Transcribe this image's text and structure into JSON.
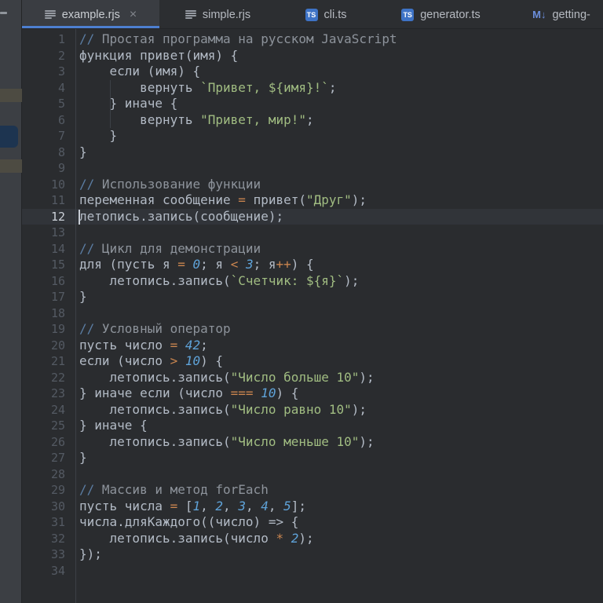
{
  "colors": {
    "accent_tab_underline": "#4d7fd0",
    "ts_icon_bg": "#3e73c6",
    "markdown_icon": "#6b8edb",
    "sidebar_selected_navy": "#1d3450",
    "sidebar_band_olive": "#4d4b42",
    "string_green": "#a1bd82",
    "number_blue": "#5fa3d9",
    "operator_orange": "#c9854f",
    "comment_slash_blue": "#5b7da3",
    "comment_gray": "#8d939b",
    "editor_bg": "#2a2c2f",
    "active_line_bg": "#313439"
  },
  "tab_bar": {
    "tabs": [
      {
        "label": "example.rjs",
        "icon": "file-lines",
        "active": true,
        "close_label": "×"
      },
      {
        "label": "simple.rjs",
        "icon": "file-lines",
        "active": false
      },
      {
        "label": "cli.ts",
        "icon": "ts-badge",
        "icon_text": "TS",
        "active": false
      },
      {
        "label": "generator.ts",
        "icon": "ts-badge",
        "icon_text": "TS",
        "active": false
      },
      {
        "label": "getting-",
        "icon": "markdown",
        "icon_text": "M↓",
        "active": false
      }
    ]
  },
  "editor": {
    "active_line_number": 12,
    "cursor": {
      "line": 12,
      "column": 0
    },
    "line_count": 34,
    "indent_guides": [
      {
        "from_line": 4,
        "to_line": 6,
        "column": 4
      }
    ],
    "lines": [
      {
        "n": 1,
        "tokens": [
          [
            "cs",
            "//"
          ],
          [
            "cm",
            " Простая программа на русском JavaScript"
          ]
        ]
      },
      {
        "n": 2,
        "tokens": [
          [
            "d",
            "функция привет(имя) {"
          ]
        ]
      },
      {
        "n": 3,
        "tokens": [
          [
            "d",
            "    если (имя) {"
          ]
        ]
      },
      {
        "n": 4,
        "tokens": [
          [
            "d",
            "        вернуть "
          ],
          [
            "s",
            "`Привет, ${имя}!`"
          ],
          [
            "d",
            ";"
          ]
        ]
      },
      {
        "n": 5,
        "tokens": [
          [
            "d",
            "    } иначе {"
          ]
        ]
      },
      {
        "n": 6,
        "tokens": [
          [
            "d",
            "        вернуть "
          ],
          [
            "s",
            "\"Привет, мир!\""
          ],
          [
            "d",
            ";"
          ]
        ]
      },
      {
        "n": 7,
        "tokens": [
          [
            "d",
            "    }"
          ]
        ]
      },
      {
        "n": 8,
        "tokens": [
          [
            "d",
            "}"
          ]
        ]
      },
      {
        "n": 9,
        "tokens": []
      },
      {
        "n": 10,
        "tokens": [
          [
            "cs",
            "//"
          ],
          [
            "cm",
            " Использование функции"
          ]
        ]
      },
      {
        "n": 11,
        "tokens": [
          [
            "d",
            "переменная сообщение "
          ],
          [
            "o",
            "="
          ],
          [
            "d",
            " привет("
          ],
          [
            "s",
            "\"Друг\""
          ],
          [
            "d",
            ");"
          ]
        ]
      },
      {
        "n": 12,
        "tokens": [
          [
            "d",
            "летопись.запись(сообщение);"
          ]
        ]
      },
      {
        "n": 13,
        "tokens": []
      },
      {
        "n": 14,
        "tokens": [
          [
            "cs",
            "//"
          ],
          [
            "cm",
            " Цикл для демонстрации"
          ]
        ]
      },
      {
        "n": 15,
        "tokens": [
          [
            "d",
            "для (пусть я "
          ],
          [
            "o",
            "="
          ],
          [
            "d",
            " "
          ],
          [
            "n",
            "0"
          ],
          [
            "d",
            "; я "
          ],
          [
            "o",
            "<"
          ],
          [
            "d",
            " "
          ],
          [
            "n",
            "3"
          ],
          [
            "d",
            "; я"
          ],
          [
            "o",
            "++"
          ],
          [
            "d",
            ") {"
          ]
        ]
      },
      {
        "n": 16,
        "tokens": [
          [
            "d",
            "    летопись.запись("
          ],
          [
            "s",
            "`Счетчик: ${я}`"
          ],
          [
            "d",
            ");"
          ]
        ]
      },
      {
        "n": 17,
        "tokens": [
          [
            "d",
            "}"
          ]
        ]
      },
      {
        "n": 18,
        "tokens": []
      },
      {
        "n": 19,
        "tokens": [
          [
            "cs",
            "//"
          ],
          [
            "cm",
            " Условный оператор"
          ]
        ]
      },
      {
        "n": 20,
        "tokens": [
          [
            "d",
            "пусть число "
          ],
          [
            "o",
            "="
          ],
          [
            "d",
            " "
          ],
          [
            "n",
            "42"
          ],
          [
            "d",
            ";"
          ]
        ]
      },
      {
        "n": 21,
        "tokens": [
          [
            "d",
            "если (число "
          ],
          [
            "o",
            ">"
          ],
          [
            "d",
            " "
          ],
          [
            "n",
            "10"
          ],
          [
            "d",
            ") {"
          ]
        ]
      },
      {
        "n": 22,
        "tokens": [
          [
            "d",
            "    летопись.запись("
          ],
          [
            "s",
            "\"Число больше 10\""
          ],
          [
            "d",
            ");"
          ]
        ]
      },
      {
        "n": 23,
        "tokens": [
          [
            "d",
            "} иначе если (число "
          ],
          [
            "o",
            "==="
          ],
          [
            "d",
            " "
          ],
          [
            "n",
            "10"
          ],
          [
            "d",
            ") {"
          ]
        ]
      },
      {
        "n": 24,
        "tokens": [
          [
            "d",
            "    летопись.запись("
          ],
          [
            "s",
            "\"Число равно 10\""
          ],
          [
            "d",
            ");"
          ]
        ]
      },
      {
        "n": 25,
        "tokens": [
          [
            "d",
            "} иначе {"
          ]
        ]
      },
      {
        "n": 26,
        "tokens": [
          [
            "d",
            "    летопись.запись("
          ],
          [
            "s",
            "\"Число меньше 10\""
          ],
          [
            "d",
            ");"
          ]
        ]
      },
      {
        "n": 27,
        "tokens": [
          [
            "d",
            "}"
          ]
        ]
      },
      {
        "n": 28,
        "tokens": []
      },
      {
        "n": 29,
        "tokens": [
          [
            "cs",
            "//"
          ],
          [
            "cm",
            " Массив и метод forEach"
          ]
        ]
      },
      {
        "n": 30,
        "tokens": [
          [
            "d",
            "пусть числа "
          ],
          [
            "o",
            "="
          ],
          [
            "d",
            " ["
          ],
          [
            "n",
            "1"
          ],
          [
            "d",
            ", "
          ],
          [
            "n",
            "2"
          ],
          [
            "d",
            ", "
          ],
          [
            "n",
            "3"
          ],
          [
            "d",
            ", "
          ],
          [
            "n",
            "4"
          ],
          [
            "d",
            ", "
          ],
          [
            "n",
            "5"
          ],
          [
            "d",
            "];"
          ]
        ]
      },
      {
        "n": 31,
        "tokens": [
          [
            "d",
            "числа.дляКаждого((число) => {"
          ]
        ]
      },
      {
        "n": 32,
        "tokens": [
          [
            "d",
            "    летопись.запись(число "
          ],
          [
            "o",
            "*"
          ],
          [
            "d",
            " "
          ],
          [
            "n",
            "2"
          ],
          [
            "d",
            ");"
          ]
        ]
      },
      {
        "n": 33,
        "tokens": [
          [
            "d",
            "});"
          ]
        ]
      },
      {
        "n": 34,
        "tokens": []
      }
    ]
  }
}
